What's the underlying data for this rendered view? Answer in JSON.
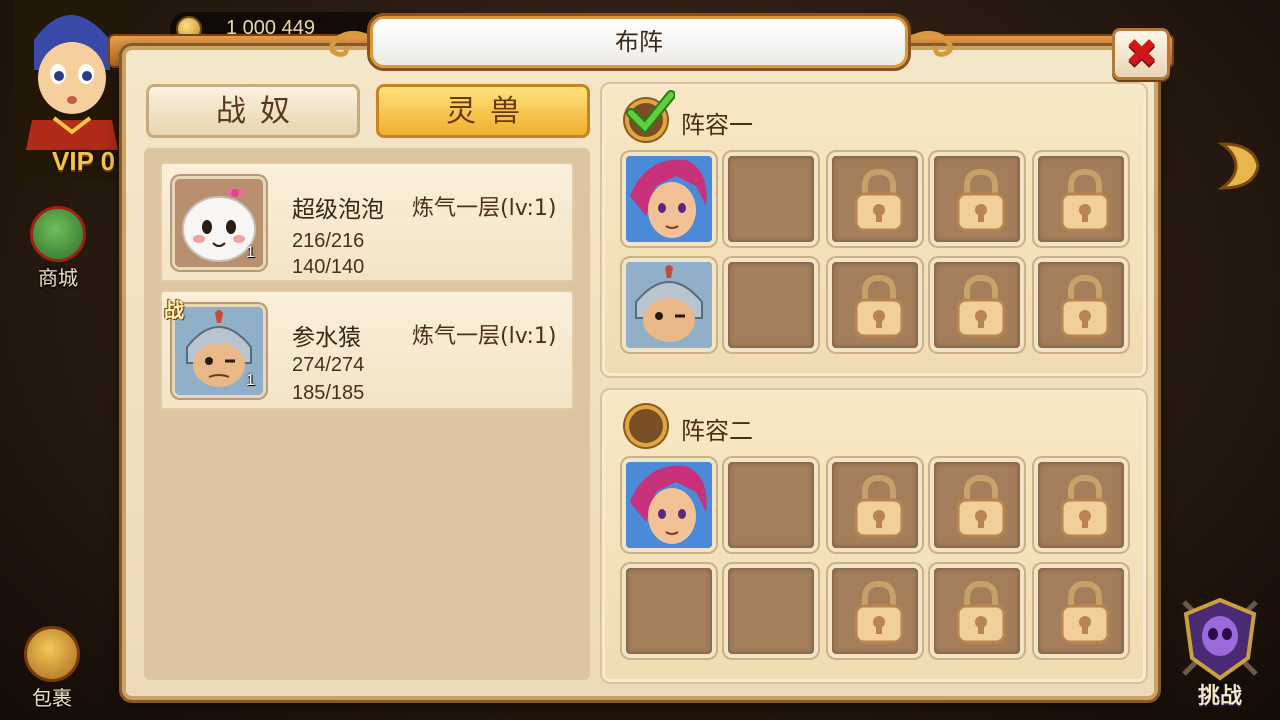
{
  "hud": {
    "vip_label": "VIP 0",
    "coins": "1 000 449",
    "shop_label": "商城",
    "bag_label": "包裹",
    "challenge_label": "挑战"
  },
  "panel": {
    "title": "布阵",
    "close_symbol": "✖"
  },
  "tabs": [
    {
      "label": "战奴",
      "active": false
    },
    {
      "label": "灵兽",
      "active": true
    }
  ],
  "units": [
    {
      "name": "超级泡泡",
      "realm": "炼气一层(lv:1)",
      "stat1": "216/216",
      "stat2": "140/140",
      "level": "1",
      "badge": "",
      "icon": "white-bubble-creature-icon"
    },
    {
      "name": "参水猿",
      "realm": "炼气一层(lv:1)",
      "stat1": "274/274",
      "stat2": "185/185",
      "level": "1",
      "badge": "战",
      "icon": "armored-monkey-warrior-icon"
    }
  ],
  "formations": [
    {
      "title": "阵容一",
      "selected": true,
      "slots": [
        {
          "state": "hero",
          "icon": "pink-hair-hero-icon"
        },
        {
          "state": "empty"
        },
        {
          "state": "locked"
        },
        {
          "state": "locked"
        },
        {
          "state": "locked"
        },
        {
          "state": "hero",
          "icon": "armored-monkey-warrior-icon"
        },
        {
          "state": "empty"
        },
        {
          "state": "locked"
        },
        {
          "state": "locked"
        },
        {
          "state": "locked"
        }
      ]
    },
    {
      "title": "阵容二",
      "selected": false,
      "slots": [
        {
          "state": "hero",
          "icon": "pink-hair-hero-icon"
        },
        {
          "state": "empty"
        },
        {
          "state": "locked"
        },
        {
          "state": "locked"
        },
        {
          "state": "locked"
        },
        {
          "state": "empty"
        },
        {
          "state": "empty"
        },
        {
          "state": "locked"
        },
        {
          "state": "locked"
        },
        {
          "state": "locked"
        }
      ]
    }
  ],
  "colors": {
    "panel_bg": "#f4e6c8",
    "active_tab": "#f1ae2e",
    "slot_bg": "#a47e5a",
    "close_red": "#d01818"
  }
}
